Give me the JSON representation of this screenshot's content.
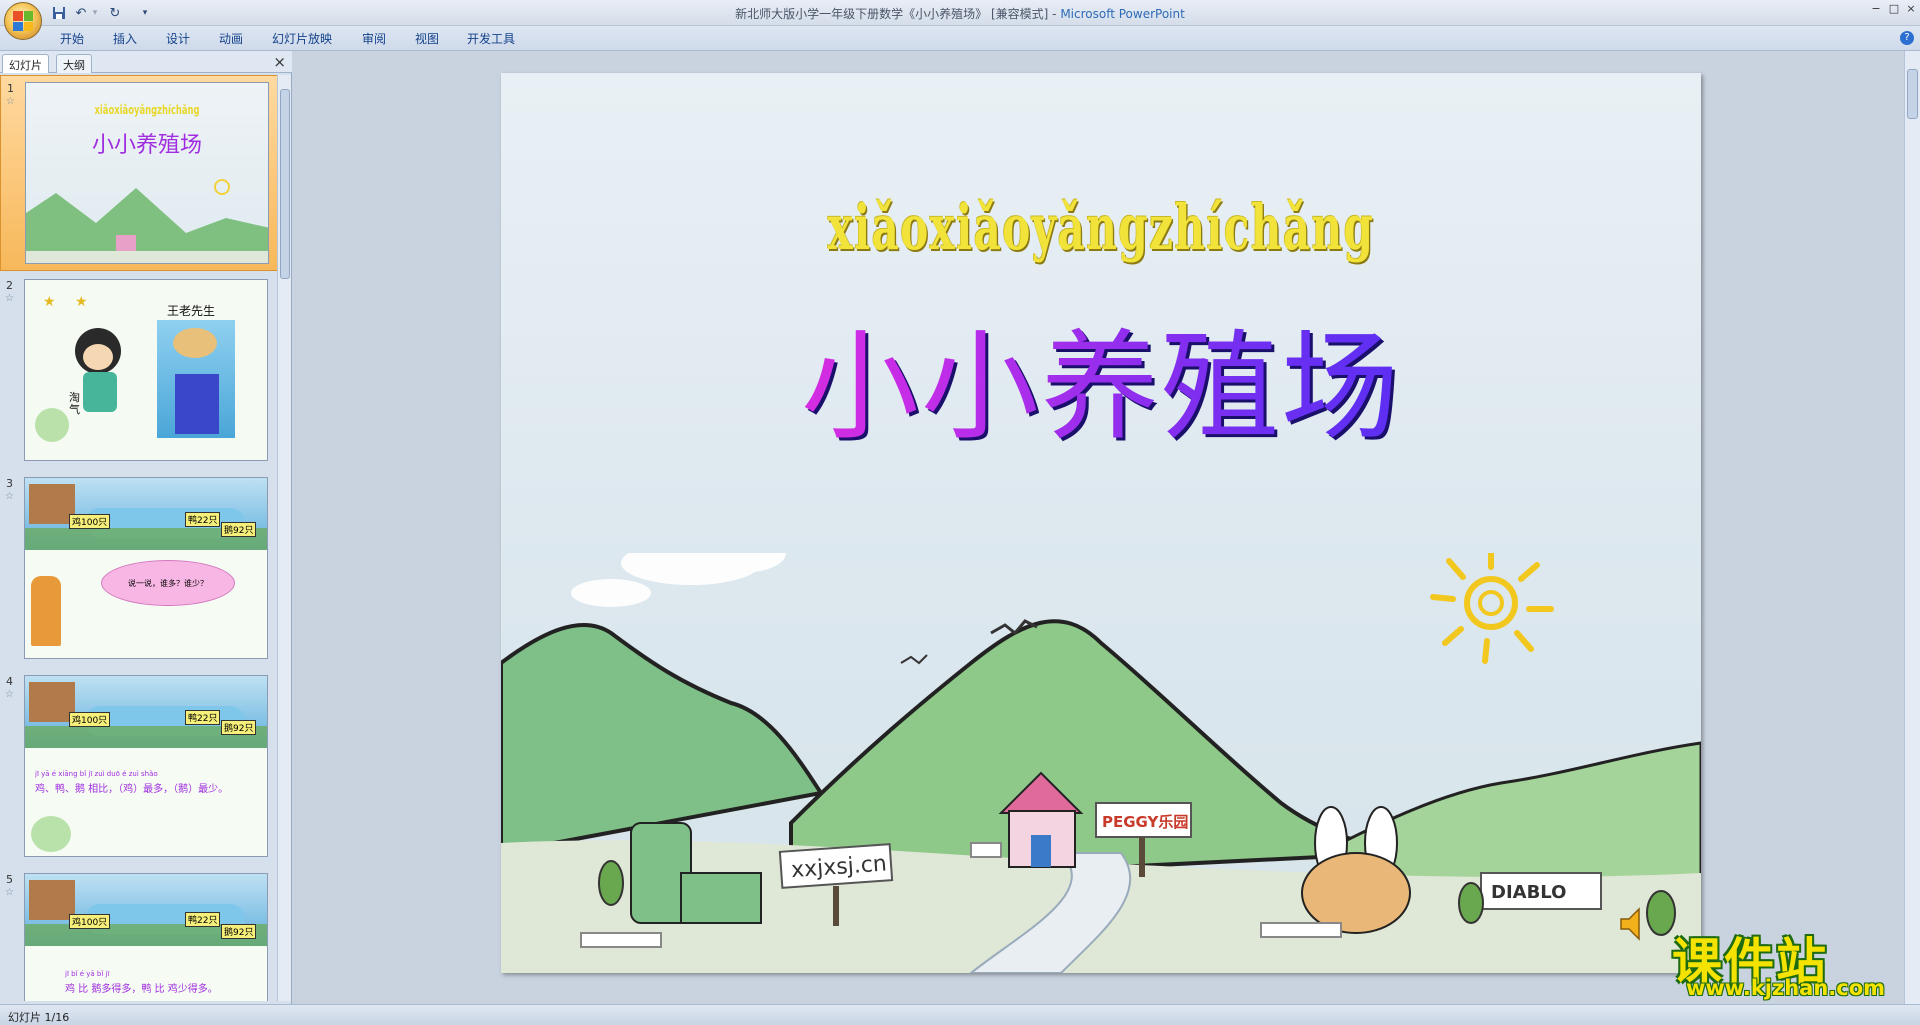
{
  "window": {
    "title": "新北师大版小学一年级下册数学《小小养殖场》 [兼容模式] - ",
    "app_name": "Microsoft PowerPoint",
    "minimize": "−",
    "maximize": "□",
    "close": "×"
  },
  "quick_access": {
    "save": "save-icon",
    "undo": "undo-icon",
    "redo": "redo-icon",
    "more": "▾"
  },
  "ribbon": {
    "tabs": [
      "开始",
      "插入",
      "设计",
      "动画",
      "幻灯片放映",
      "审阅",
      "视图",
      "开发工具"
    ],
    "help": "?"
  },
  "left_pane": {
    "tabs": [
      "幻灯片",
      "大纲"
    ],
    "close": "×",
    "slides": [
      {
        "num": "1",
        "title_pinyin": "xiǎoxiǎoyǎngzhíchǎng",
        "title": "小小养殖场"
      },
      {
        "num": "2",
        "caption": "王老先生",
        "label": "淘气"
      },
      {
        "num": "3",
        "labels": [
          "鸡100只",
          "鸭22只",
          "鹅92只"
        ],
        "bubble": "说一说，谁多？谁少？"
      },
      {
        "num": "4",
        "labels": [
          "鸡100只",
          "鸭22只",
          "鹅92只"
        ],
        "pinyin": "jī  yā  é  xiāng bǐ    jī  zuì duō    é  zuì shǎo",
        "text": "鸡、鸭、鹅 相比，（鸡）最多，（鹅）最少。"
      },
      {
        "num": "5",
        "labels": [
          "鸡100只",
          "鸭22只",
          "鹅92只"
        ],
        "pinyin": "jī  bǐ    é     yā  bǐ  jī",
        "text": "鸡 比 鹅多得多，鸭 比 鸡少得多。"
      }
    ]
  },
  "slide": {
    "pinyin": "xiǎoxiǎoyǎngzhíchǎng",
    "title": "小小养殖场",
    "signs": [
      "xxjxsj.cn",
      "PEGGY乐园",
      "DIABLO"
    ]
  },
  "status": {
    "text": "幻灯片 1/16"
  },
  "watermark": {
    "cn": "课件站",
    "url": "www.kjzhan.com"
  }
}
